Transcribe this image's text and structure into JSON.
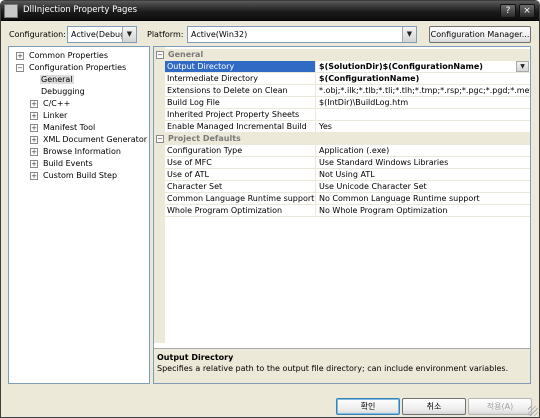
{
  "window": {
    "title": "DllInjection Property Pages",
    "help_icon": "help-icon",
    "close_icon": "close-icon",
    "help_glyph": "?",
    "close_glyph": "×"
  },
  "config_bar": {
    "configuration_label": "Configuration:",
    "configuration_value": "Active(Debug)",
    "platform_label": "Platform:",
    "platform_value": "Active(Win32)",
    "manager_button": "Configuration Manager..."
  },
  "tree": {
    "items": [
      {
        "label": "Common Properties",
        "expander": "+"
      },
      {
        "label": "Configuration Properties",
        "expander": "−"
      },
      {
        "label": "General",
        "selected": true
      },
      {
        "label": "Debugging"
      },
      {
        "label": "C/C++",
        "expander": "+"
      },
      {
        "label": "Linker",
        "expander": "+"
      },
      {
        "label": "Manifest Tool",
        "expander": "+"
      },
      {
        "label": "XML Document Generator",
        "expander": "+"
      },
      {
        "label": "Browse Information",
        "expander": "+"
      },
      {
        "label": "Build Events",
        "expander": "+"
      },
      {
        "label": "Custom Build Step",
        "expander": "+"
      }
    ]
  },
  "grid": {
    "categories": [
      {
        "label": "General",
        "expander": "−",
        "rows": [
          {
            "name": "Output Directory",
            "value": "$(SolutionDir)$(ConfigurationName)",
            "bold": true,
            "selected": true
          },
          {
            "name": "Intermediate Directory",
            "value": "$(ConfigurationName)",
            "bold": true
          },
          {
            "name": "Extensions to Delete on Clean",
            "value": "*.obj;*.ilk;*.tlb;*.tli;*.tlh;*.tmp;*.rsp;*.pgc;*.pgd;*.meta;$"
          },
          {
            "name": "Build Log File",
            "value": "$(IntDir)\\BuildLog.htm"
          },
          {
            "name": "Inherited Project Property Sheets",
            "value": ""
          },
          {
            "name": "Enable Managed Incremental Build",
            "value": "Yes"
          }
        ]
      },
      {
        "label": "Project Defaults",
        "expander": "−",
        "rows": [
          {
            "name": "Configuration Type",
            "value": "Application (.exe)"
          },
          {
            "name": "Use of MFC",
            "value": "Use Standard Windows Libraries"
          },
          {
            "name": "Use of ATL",
            "value": "Not Using ATL"
          },
          {
            "name": "Character Set",
            "value": "Use Unicode Character Set"
          },
          {
            "name": "Common Language Runtime support",
            "value": "No Common Language Runtime support"
          },
          {
            "name": "Whole Program Optimization",
            "value": "No Whole Program Optimization"
          }
        ]
      }
    ],
    "description": {
      "title": "Output Directory",
      "text": "Specifies a relative path to the output file directory; can include environment variables."
    }
  },
  "footer": {
    "ok_button": "확인",
    "cancel_button": "취소",
    "apply_button": "적용(A)"
  },
  "icons": {
    "dropdown": "chevron-down-icon",
    "dropdown_glyph": "▼"
  },
  "colors": {
    "selection": "#316ac5",
    "face": "#ece9d8",
    "titlebar": "#1c1c1c"
  }
}
